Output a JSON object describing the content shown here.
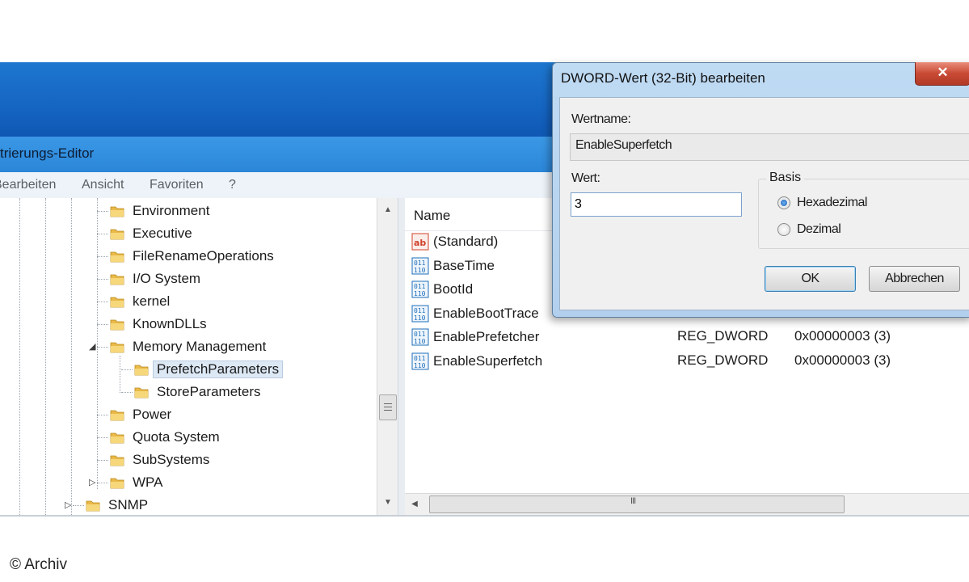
{
  "window": {
    "title": "trierungs-Editor",
    "menu": [
      "Bearbeiten",
      "Ansicht",
      "Favoriten",
      "?"
    ]
  },
  "tree": {
    "items": [
      {
        "label": "Environment",
        "expander": ""
      },
      {
        "label": "Executive",
        "expander": ""
      },
      {
        "label": "FileRenameOperations",
        "expander": ""
      },
      {
        "label": "I/O System",
        "expander": ""
      },
      {
        "label": "kernel",
        "expander": ""
      },
      {
        "label": "KnownDLLs",
        "expander": ""
      },
      {
        "label": "Memory Management",
        "expander": "◢"
      },
      {
        "label": "PrefetchParameters",
        "expander": ""
      },
      {
        "label": "StoreParameters",
        "expander": ""
      },
      {
        "label": "Power",
        "expander": ""
      },
      {
        "label": "Quota System",
        "expander": ""
      },
      {
        "label": "SubSystems",
        "expander": ""
      },
      {
        "label": "WPA",
        "expander": "▷"
      },
      {
        "label": "SNMP",
        "expander": "▷"
      }
    ],
    "selected": "PrefetchParameters"
  },
  "list": {
    "columns": {
      "name": "Name"
    },
    "rows": [
      {
        "name": "(Standard)",
        "icon": "string-value-icon",
        "type": "",
        "data": ""
      },
      {
        "name": "BaseTime",
        "icon": "dword-value-icon",
        "type": "",
        "data": ""
      },
      {
        "name": "BootId",
        "icon": "dword-value-icon",
        "type": "",
        "data": ""
      },
      {
        "name": "EnableBootTrace",
        "icon": "dword-value-icon",
        "type": "",
        "data": ""
      },
      {
        "name": "EnablePrefetcher",
        "icon": "dword-value-icon",
        "type": "REG_DWORD",
        "data": "0x00000003 (3)"
      },
      {
        "name": "EnableSuperfetch",
        "icon": "dword-value-icon",
        "type": "REG_DWORD",
        "data": "0x00000003 (3)"
      }
    ],
    "hscroll_grip": "III"
  },
  "dialog": {
    "title": "DWORD-Wert (32-Bit) bearbeiten",
    "close": "✕",
    "name_label": "Wertname:",
    "name_value": "EnableSuperfetch",
    "value_label": "Wert:",
    "value": "3",
    "basis_label": "Basis",
    "hex_label": "Hexadezimal",
    "dec_label": "Dezimal",
    "hex_checked": true,
    "ok": "OK",
    "cancel": "Abbrechen"
  },
  "copyright": "© Archiv",
  "colors": {
    "title_bar": "#1e77cf",
    "dialog_frame": "#bfdaf3",
    "close_button": "#c84a35",
    "dword_icon": "#1f6fb8",
    "string_icon": "#d0412b"
  }
}
